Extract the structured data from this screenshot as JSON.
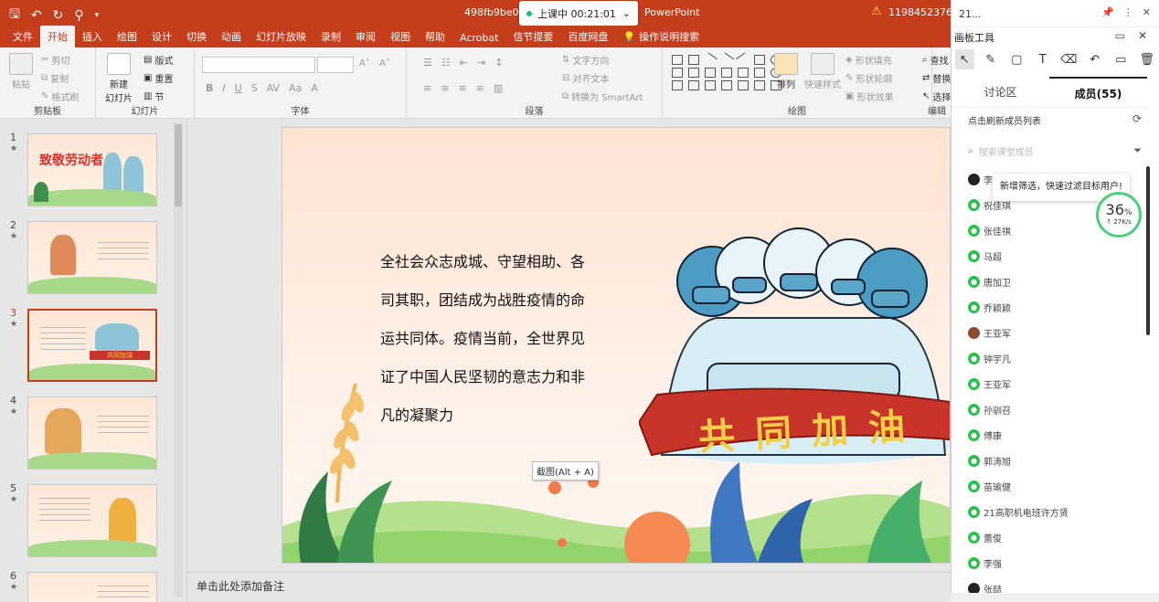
{
  "titlebar": {
    "doc_title": "498fb9be09",
    "app_name": "PowerPoint",
    "user": "1198452376@",
    "timer_label": "上课中 00:21:01"
  },
  "qat_icons": [
    "save-icon",
    "undo-icon",
    "redo-icon",
    "brush-icon",
    "customize-icon"
  ],
  "tabs": [
    {
      "label": "文件"
    },
    {
      "label": "开始"
    },
    {
      "label": "插入"
    },
    {
      "label": "绘图"
    },
    {
      "label": "设计"
    },
    {
      "label": "切换"
    },
    {
      "label": "动画"
    },
    {
      "label": "幻灯片放映"
    },
    {
      "label": "录制"
    },
    {
      "label": "审阅"
    },
    {
      "label": "视图"
    },
    {
      "label": "帮助"
    },
    {
      "label": "Acrobat"
    },
    {
      "label": "信节提要"
    },
    {
      "label": "百度网盘"
    }
  ],
  "help_tab": "操作说明搜索",
  "ribbon": {
    "paste": "粘贴",
    "cut": "剪切",
    "copy": "复制",
    "format_painter": "格式刷",
    "clipboard": "剪贴板",
    "new_slide_l1": "新建",
    "new_slide_l2": "幻灯片",
    "layout": "版式",
    "reset": "重置",
    "section": "节",
    "slides": "幻灯片",
    "font": "字体",
    "text_direction": "文字方向",
    "align_text": "对齐文本",
    "convert_smartart": "转换为 SmartArt",
    "paragraph": "段落",
    "arrange": "排列",
    "quick_styles": "快速样式",
    "shape_fill": "形状填充",
    "shape_outline": "形状轮廓",
    "shape_effect": "形状效果",
    "drawing": "绘图",
    "find": "查找",
    "replace": "替换",
    "select": "选择",
    "edit": "编辑"
  },
  "thumbnails": [
    {
      "num": "1",
      "title": "致敬劳动者"
    },
    {
      "num": "2"
    },
    {
      "num": "3",
      "banner": "共同加油"
    },
    {
      "num": "4"
    },
    {
      "num": "5"
    },
    {
      "num": "6"
    }
  ],
  "slide": {
    "lines": [
      "全社会众志成城、守望相助、各",
      "司其职，团结成为战胜疫情的命",
      "运共同体。疫情当前，全世界见",
      "证了中国人民坚韧的意志力和非",
      "凡的凝聚力"
    ],
    "banner_text": "共同加油"
  },
  "tooltip": "截图(Alt + A)",
  "notes": "单击此处添加备注",
  "panel": {
    "window_num": "21...",
    "title": "画板工具",
    "tabs": [
      {
        "label": "讨论区"
      },
      {
        "label": "成员(55)"
      }
    ],
    "refresh": "点击刷新成员列表",
    "search_placeholder": "搜索课堂成员",
    "filter_tip": "新增筛选，快速过滤目标用户!",
    "speed_pct": "36",
    "speed_unit": "%",
    "speed_rate": "↑ 27K/s",
    "members": [
      {
        "name": "李",
        "icon": "qq"
      },
      {
        "name": "祝佳琪",
        "icon": "wechat"
      },
      {
        "name": "张佳祺",
        "icon": "wechat"
      },
      {
        "name": "马超",
        "icon": "wechat"
      },
      {
        "name": "唐加卫",
        "icon": "wechat"
      },
      {
        "name": "乔颖颖",
        "icon": "wechat"
      },
      {
        "name": "王亚军",
        "icon": "avatar"
      },
      {
        "name": "钟宇凡",
        "icon": "wechat"
      },
      {
        "name": "王亚军",
        "icon": "wechat"
      },
      {
        "name": "孙驯召",
        "icon": "wechat"
      },
      {
        "name": "傅康",
        "icon": "wechat"
      },
      {
        "name": "郭涛旭",
        "icon": "wechat"
      },
      {
        "name": "苗瑜健",
        "icon": "wechat"
      },
      {
        "name": "21高职机电班许方贤",
        "icon": "wechat"
      },
      {
        "name": "蕾俊",
        "icon": "wechat"
      },
      {
        "name": "李强",
        "icon": "wechat"
      },
      {
        "name": "张喆",
        "icon": "qq"
      }
    ]
  },
  "colors": {
    "accent": "#c43e1c",
    "wechat": "#2ac14f",
    "speed_ring": "#4cd07d"
  }
}
